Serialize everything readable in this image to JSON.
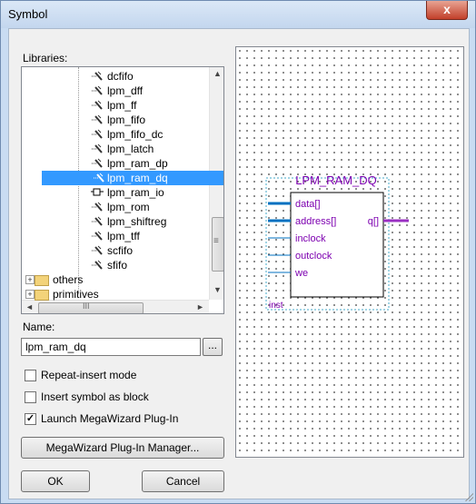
{
  "window": {
    "title": "Symbol",
    "close_label": "x"
  },
  "libraries_label": "Libraries:",
  "tree": {
    "items": [
      {
        "label": "dcfifo",
        "icon": "megafunction-icon"
      },
      {
        "label": "lpm_dff",
        "icon": "megafunction-icon"
      },
      {
        "label": "lpm_ff",
        "icon": "megafunction-icon"
      },
      {
        "label": "lpm_fifo",
        "icon": "megafunction-icon"
      },
      {
        "label": "lpm_fifo_dc",
        "icon": "megafunction-icon"
      },
      {
        "label": "lpm_latch",
        "icon": "megafunction-icon"
      },
      {
        "label": "lpm_ram_dp",
        "icon": "megafunction-icon"
      },
      {
        "label": "lpm_ram_dq",
        "icon": "megafunction-icon",
        "selected": true
      },
      {
        "label": "lpm_ram_io",
        "icon": "symbol-icon"
      },
      {
        "label": "lpm_rom",
        "icon": "megafunction-icon"
      },
      {
        "label": "lpm_shiftreg",
        "icon": "megafunction-icon"
      },
      {
        "label": "lpm_tff",
        "icon": "megafunction-icon"
      },
      {
        "label": "scfifo",
        "icon": "megafunction-icon"
      },
      {
        "label": "sfifo",
        "icon": "megafunction-icon"
      }
    ],
    "folders": [
      {
        "label": "others",
        "expander": "+"
      },
      {
        "label": "primitives",
        "expander": "+"
      }
    ],
    "scroll_left": "◄",
    "scroll_right": "►",
    "scroll_up": "▲",
    "scroll_down": "▼",
    "hscroll_grip": "III",
    "vscroll_grip": "≡"
  },
  "name_label": "Name:",
  "name_value": "lpm_ram_dq",
  "browse_label": "...",
  "options": [
    {
      "label": "Repeat-insert mode",
      "checked": false
    },
    {
      "label": "Insert symbol as block",
      "checked": false
    },
    {
      "label": "Launch MegaWizard Plug-In",
      "checked": true
    }
  ],
  "megawizard_button": "MegaWizard Plug-In Manager...",
  "ok_button": "OK",
  "cancel_button": "Cancel",
  "symbol": {
    "title": "LPM_RAM_DQ",
    "inputs": [
      "data[]",
      "address[]",
      "inclock",
      "outclock",
      "we"
    ],
    "output": "q[]",
    "instance": "inst",
    "colors": {
      "pin": "#0070c0",
      "label": "#7d00b0",
      "bus_out": "#9a2fc2"
    }
  }
}
